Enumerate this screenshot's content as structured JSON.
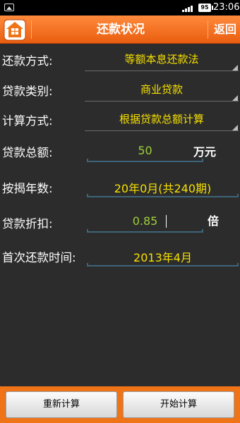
{
  "status_bar": {
    "battery": "95",
    "time": "23:06"
  },
  "header": {
    "title": "还款状况",
    "back_label": "返回",
    "home_icon": "house-icon"
  },
  "form": {
    "repay_method": {
      "label": "还款方式:",
      "value": "等额本息还款法"
    },
    "loan_type": {
      "label": "贷款类别:",
      "value": "商业贷款"
    },
    "calc_method": {
      "label": "计算方式:",
      "value": "根据贷款总额计算"
    },
    "loan_amount": {
      "label": "贷款总额:",
      "value": "50",
      "unit": "万元"
    },
    "loan_years": {
      "label": "按揭年数:",
      "value": "20年0月(共240期)"
    },
    "discount": {
      "label": "贷款折扣:",
      "value": "0.85",
      "unit": "倍"
    },
    "first_payment": {
      "label": "首次还款时间:",
      "value": "2013年4月"
    }
  },
  "buttons": {
    "reset": "重新计算",
    "start": "开始计算"
  },
  "colors": {
    "accent": "#ef7418",
    "value_yellow": "#f6e000",
    "value_green": "#9fd03a",
    "background": "#2c2c2c"
  }
}
